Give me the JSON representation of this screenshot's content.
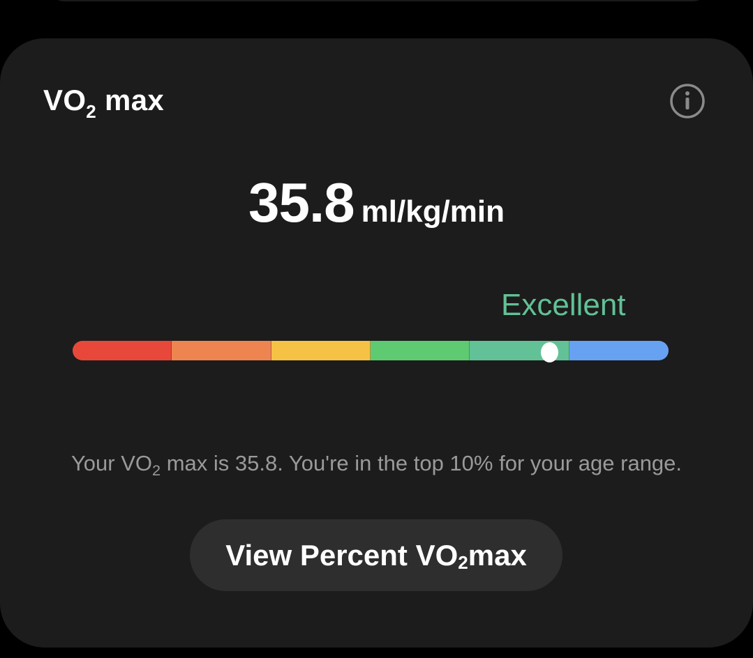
{
  "card": {
    "title_prefix": "VO",
    "title_subscript": "2",
    "title_suffix": " max",
    "info_icon": "info-circle-icon"
  },
  "reading": {
    "value": "35.8",
    "unit": "ml/kg/min",
    "rating": "Excellent",
    "rating_color": "#62c196"
  },
  "gauge": {
    "segments": [
      {
        "color": "#e8483a"
      },
      {
        "color": "#ee8551"
      },
      {
        "color": "#f5c245"
      },
      {
        "color": "#5ecb72"
      },
      {
        "color": "#62c196"
      },
      {
        "color": "#67a1f2"
      }
    ],
    "marker_fraction": 0.8
  },
  "summary": {
    "text_prefix": "Your VO",
    "text_subscript": "2",
    "text_suffix": " max is 35.8. You're in the top 10% for your age range."
  },
  "action": {
    "label_prefix": "View Percent VO",
    "label_subscript": "2",
    "label_suffix": " max"
  }
}
